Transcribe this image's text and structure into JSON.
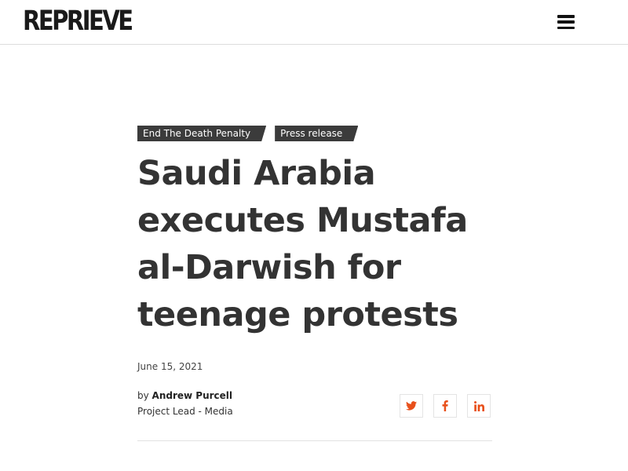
{
  "header": {
    "logo_text": "REPRIEVE",
    "menu_icon": "hamburger-menu-icon"
  },
  "article": {
    "tags": [
      {
        "label": "End The Death Penalty"
      },
      {
        "label": "Press release"
      }
    ],
    "title": "Saudi Arabia executes Mustafa al-Darwish for teenage protests",
    "date": "June 15, 2021",
    "byline_prefix": "by",
    "author_name": "Andrew Purcell",
    "author_role": "Project Lead - Media"
  },
  "share": {
    "icons": [
      "twitter-icon",
      "facebook-icon",
      "linkedin-icon"
    ],
    "icon_color": "#e8501b"
  },
  "colors": {
    "accent": "#e8501b",
    "tag_background": "#3b3b3b",
    "title_text": "#333333"
  }
}
